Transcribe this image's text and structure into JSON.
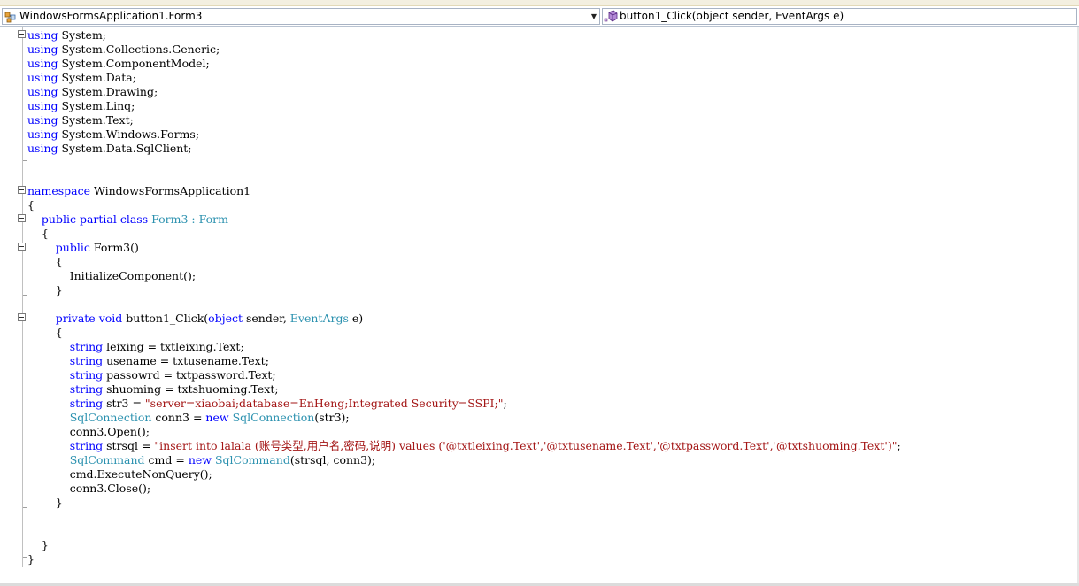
{
  "navbar": {
    "class_combo": {
      "label": "WindowsFormsApplication1.Form3",
      "icon": "class-icon"
    },
    "member_combo": {
      "label": "button1_Click(object sender, EventArgs e)",
      "icon": "method-icon"
    }
  },
  "colors": {
    "keyword": "#0000ff",
    "type": "#2b91af",
    "string": "#a31515",
    "text": "#000000"
  },
  "code": {
    "lines": [
      {
        "indent": "",
        "tokens": [
          {
            "t": "using",
            "c": "k"
          },
          {
            "t": " System;"
          }
        ]
      },
      {
        "indent": "",
        "tokens": [
          {
            "t": "using",
            "c": "k"
          },
          {
            "t": " System.Collections.Generic;"
          }
        ]
      },
      {
        "indent": "",
        "tokens": [
          {
            "t": "using",
            "c": "k"
          },
          {
            "t": " System.ComponentModel;"
          }
        ]
      },
      {
        "indent": "",
        "tokens": [
          {
            "t": "using",
            "c": "k"
          },
          {
            "t": " System.Data;"
          }
        ]
      },
      {
        "indent": "",
        "tokens": [
          {
            "t": "using",
            "c": "k"
          },
          {
            "t": " System.Drawing;"
          }
        ]
      },
      {
        "indent": "",
        "tokens": [
          {
            "t": "using",
            "c": "k"
          },
          {
            "t": " System.Linq;"
          }
        ]
      },
      {
        "indent": "",
        "tokens": [
          {
            "t": "using",
            "c": "k"
          },
          {
            "t": " System.Text;"
          }
        ]
      },
      {
        "indent": "",
        "tokens": [
          {
            "t": "using",
            "c": "k"
          },
          {
            "t": " System.Windows.Forms;"
          }
        ]
      },
      {
        "indent": "",
        "tokens": [
          {
            "t": "using",
            "c": "k"
          },
          {
            "t": " System.Data.SqlClient;"
          }
        ]
      },
      {
        "indent": "",
        "tokens": []
      },
      {
        "indent": "",
        "tokens": []
      },
      {
        "indent": "",
        "tokens": [
          {
            "t": "namespace",
            "c": "k"
          },
          {
            "t": " WindowsFormsApplication1"
          }
        ]
      },
      {
        "indent": "",
        "tokens": [
          {
            "t": "{"
          }
        ]
      },
      {
        "indent": "    ",
        "tokens": [
          {
            "t": "public",
            "c": "k"
          },
          {
            "t": " "
          },
          {
            "t": "partial",
            "c": "k"
          },
          {
            "t": " "
          },
          {
            "t": "class",
            "c": "k"
          },
          {
            "t": " "
          },
          {
            "t": "Form3",
            "c": "t"
          },
          {
            "t": " : ",
            "c": "t"
          },
          {
            "t": "Form",
            "c": "t"
          }
        ]
      },
      {
        "indent": "    ",
        "tokens": [
          {
            "t": "{"
          }
        ]
      },
      {
        "indent": "        ",
        "tokens": [
          {
            "t": "public",
            "c": "k"
          },
          {
            "t": " Form3()"
          }
        ]
      },
      {
        "indent": "        ",
        "tokens": [
          {
            "t": "{"
          }
        ]
      },
      {
        "indent": "            ",
        "tokens": [
          {
            "t": "InitializeComponent();"
          }
        ]
      },
      {
        "indent": "        ",
        "tokens": [
          {
            "t": "}"
          }
        ]
      },
      {
        "indent": "",
        "tokens": []
      },
      {
        "indent": "        ",
        "tokens": [
          {
            "t": "private",
            "c": "k"
          },
          {
            "t": " "
          },
          {
            "t": "void",
            "c": "k"
          },
          {
            "t": " button1_Click("
          },
          {
            "t": "object",
            "c": "k"
          },
          {
            "t": " sender, "
          },
          {
            "t": "EventArgs",
            "c": "t"
          },
          {
            "t": " e)"
          }
        ]
      },
      {
        "indent": "        ",
        "tokens": [
          {
            "t": "{"
          }
        ]
      },
      {
        "indent": "            ",
        "tokens": [
          {
            "t": "string",
            "c": "k"
          },
          {
            "t": " leixing = txtleixing.Text;"
          }
        ]
      },
      {
        "indent": "            ",
        "tokens": [
          {
            "t": "string",
            "c": "k"
          },
          {
            "t": " usename = txtusename.Text;"
          }
        ]
      },
      {
        "indent": "            ",
        "tokens": [
          {
            "t": "string",
            "c": "k"
          },
          {
            "t": " passowrd = txtpassword.Text;"
          }
        ]
      },
      {
        "indent": "            ",
        "tokens": [
          {
            "t": "string",
            "c": "k"
          },
          {
            "t": " shuoming = txtshuoming.Text;"
          }
        ]
      },
      {
        "indent": "            ",
        "tokens": [
          {
            "t": "string",
            "c": "k"
          },
          {
            "t": " str3 = "
          },
          {
            "t": "\"server=xiaobai;database=EnHeng;Integrated Security=SSPI;\"",
            "c": "s"
          },
          {
            "t": ";"
          }
        ]
      },
      {
        "indent": "            ",
        "tokens": [
          {
            "t": "SqlConnection",
            "c": "t"
          },
          {
            "t": " conn3 = "
          },
          {
            "t": "new",
            "c": "k"
          },
          {
            "t": " "
          },
          {
            "t": "SqlConnection",
            "c": "t"
          },
          {
            "t": "(str3);"
          }
        ]
      },
      {
        "indent": "            ",
        "tokens": [
          {
            "t": "conn3.Open();"
          }
        ]
      },
      {
        "indent": "            ",
        "tokens": [
          {
            "t": "string",
            "c": "k"
          },
          {
            "t": " strsql = "
          },
          {
            "t": "\"insert into lalala (账号类型,用户名,密码,说明) values ('@txtleixing.Text','@txtusename.Text','@txtpassword.Text','@txtshuoming.Text')\"",
            "c": "s"
          },
          {
            "t": ";"
          }
        ]
      },
      {
        "indent": "            ",
        "tokens": [
          {
            "t": "SqlCommand",
            "c": "t"
          },
          {
            "t": " cmd = "
          },
          {
            "t": "new",
            "c": "k"
          },
          {
            "t": " "
          },
          {
            "t": "SqlCommand",
            "c": "t"
          },
          {
            "t": "(strsql, conn3);"
          }
        ]
      },
      {
        "indent": "            ",
        "tokens": [
          {
            "t": "cmd.ExecuteNonQuery();"
          }
        ]
      },
      {
        "indent": "            ",
        "tokens": [
          {
            "t": "conn3.Close();"
          }
        ]
      },
      {
        "indent": "        ",
        "tokens": [
          {
            "t": "}"
          }
        ]
      },
      {
        "indent": "",
        "tokens": []
      },
      {
        "indent": "",
        "tokens": []
      },
      {
        "indent": "    ",
        "tokens": [
          {
            "t": "}"
          }
        ]
      },
      {
        "indent": "",
        "tokens": [
          {
            "t": "}"
          }
        ]
      }
    ]
  }
}
